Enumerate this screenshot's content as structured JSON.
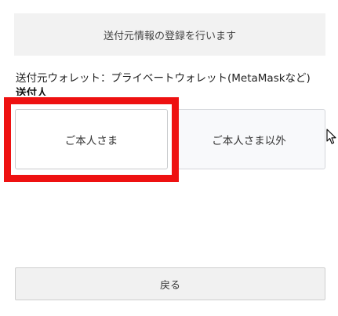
{
  "banner": {
    "text": "送付元情報の登録を行います"
  },
  "wallet": {
    "line": "送付元ウォレット：プライベートウォレット(MetaMaskなど)"
  },
  "sender": {
    "label": "送付人"
  },
  "options": [
    {
      "label": "ご本人さま",
      "selected": true
    },
    {
      "label": "ご本人さま以外",
      "selected": false
    }
  ],
  "buttons": {
    "back_label": "戻る"
  },
  "highlight": {
    "color": "#ee1111"
  },
  "cursor": {
    "icon": "mouse-pointer-icon"
  }
}
